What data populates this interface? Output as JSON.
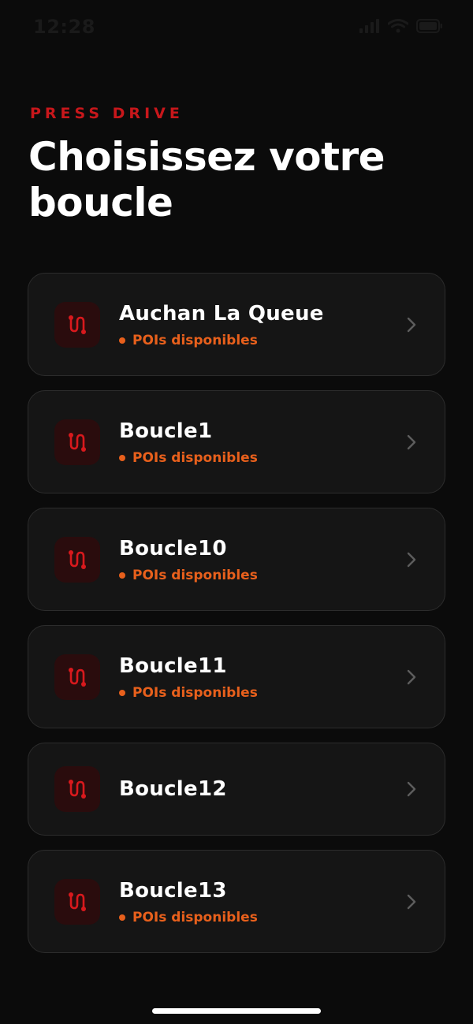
{
  "status_bar": {
    "time": "12:28",
    "icons": [
      "signal-icon",
      "wifi-icon",
      "battery-icon"
    ]
  },
  "header": {
    "brand": "PRESS DRIVE",
    "title": "Choisissez votre boucle"
  },
  "colors": {
    "background": "#0b0b0b",
    "card": "#151515",
    "brand_red": "#c8171b",
    "status_orange": "#e8601c"
  },
  "loops": [
    {
      "name": "Auchan La Queue",
      "status": "POIs disponibles",
      "icon": "route-icon"
    },
    {
      "name": "Boucle1",
      "status": "POIs disponibles",
      "icon": "route-icon"
    },
    {
      "name": "Boucle10",
      "status": "POIs disponibles",
      "icon": "route-icon"
    },
    {
      "name": "Boucle11",
      "status": "POIs disponibles",
      "icon": "route-icon"
    },
    {
      "name": "Boucle12",
      "status": "",
      "icon": "route-icon"
    },
    {
      "name": "Boucle13",
      "status": "POIs disponibles",
      "icon": "route-icon"
    }
  ]
}
